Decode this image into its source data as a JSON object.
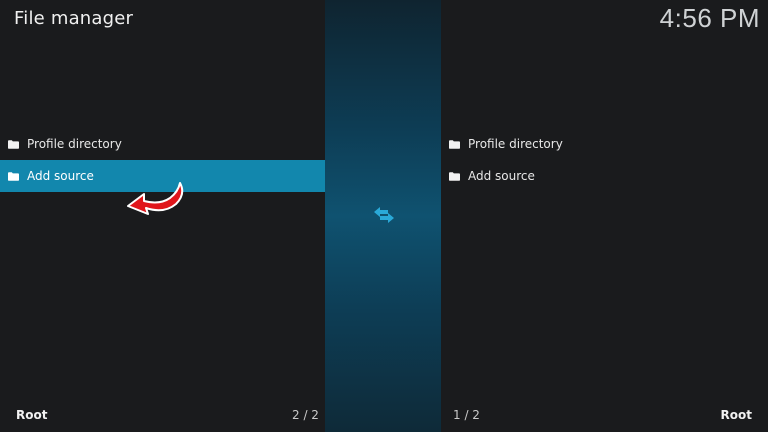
{
  "header": {
    "title": "File manager",
    "clock": "4:56 PM"
  },
  "left_panel": {
    "items": [
      {
        "label": "Profile directory",
        "icon": "folder-icon"
      },
      {
        "label": "Add source",
        "icon": "folder-icon",
        "focused": true
      }
    ],
    "footer_label": "Root",
    "footer_count": "2 / 2"
  },
  "right_panel": {
    "items": [
      {
        "label": "Profile directory",
        "icon": "folder-icon"
      },
      {
        "label": "Add source",
        "icon": "folder-icon"
      }
    ],
    "footer_label": "Root",
    "footer_count": "1 / 2"
  },
  "center": {
    "icon": "swap-arrows-icon"
  },
  "colors": {
    "accent": "#1287ad",
    "background": "#1a1b1d",
    "annotation_arrow": "#e0161b"
  }
}
